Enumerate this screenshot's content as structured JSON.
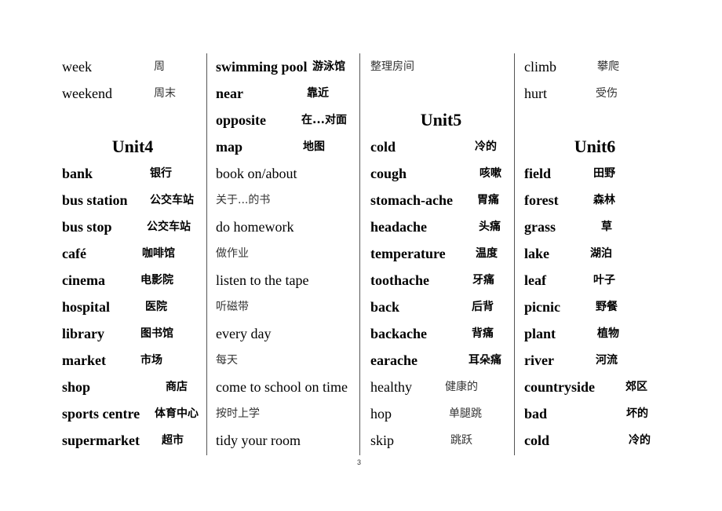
{
  "page_number": "3",
  "columns": [
    {
      "rows": [
        {
          "type": "pair",
          "en": "week",
          "zh": "周",
          "bold": false
        },
        {
          "type": "pair",
          "en": "weekend",
          "zh": "周末",
          "bold": false
        },
        {
          "type": "blank"
        },
        {
          "type": "heading",
          "text": "Unit4"
        },
        {
          "type": "pair",
          "en": "bank",
          "zh": "银行",
          "bold": true
        },
        {
          "type": "pair",
          "en": "bus station",
          "zh": "公交车站",
          "bold": true
        },
        {
          "type": "pair",
          "en": "bus stop",
          "zh": "公交车站",
          "bold": true
        },
        {
          "type": "pair",
          "en": "café",
          "zh": "咖啡馆",
          "bold": true
        },
        {
          "type": "pair",
          "en": "cinema",
          "zh": "电影院",
          "bold": true
        },
        {
          "type": "pair",
          "en": "hospital",
          "zh": "医院",
          "bold": true
        },
        {
          "type": "pair",
          "en": "library",
          "zh": "图书馆",
          "bold": true
        },
        {
          "type": "pair",
          "en": "market",
          "zh": "市场",
          "bold": true
        },
        {
          "type": "pair",
          "en": "shop",
          "zh": "商店",
          "bold": true
        },
        {
          "type": "pair",
          "en": "sports centre",
          "zh": "体育中心",
          "bold": true
        },
        {
          "type": "pair",
          "en": "supermarket",
          "zh": "超市",
          "bold": true
        }
      ]
    },
    {
      "rows": [
        {
          "type": "pair",
          "en": "swimming pool",
          "zh": "游泳馆",
          "bold": true
        },
        {
          "type": "pair",
          "en": "near",
          "zh": "靠近",
          "bold": true
        },
        {
          "type": "pair",
          "en": "opposite",
          "zh": "在...对面",
          "bold": true
        },
        {
          "type": "pair",
          "en": "map",
          "zh": "地图",
          "bold": true
        },
        {
          "type": "en",
          "text": "book on/about"
        },
        {
          "type": "zh",
          "text": "关于...的书"
        },
        {
          "type": "en",
          "text": "do homework"
        },
        {
          "type": "zh",
          "text": "做作业"
        },
        {
          "type": "en",
          "text": "listen to the tape"
        },
        {
          "type": "zh",
          "text": "听磁带"
        },
        {
          "type": "en",
          "text": "every day"
        },
        {
          "type": "zh",
          "text": "每天"
        },
        {
          "type": "en",
          "text": "come to school on time"
        },
        {
          "type": "zh",
          "text": "按时上学"
        },
        {
          "type": "en",
          "text": "tidy your room"
        }
      ]
    },
    {
      "rows": [
        {
          "type": "zh",
          "text": "整理房间"
        },
        {
          "type": "blank"
        },
        {
          "type": "heading",
          "text": "Unit5"
        },
        {
          "type": "pair",
          "en": "cold",
          "zh": "冷的",
          "bold": true
        },
        {
          "type": "pair",
          "en": "cough",
          "zh": "咳嗽",
          "bold": true
        },
        {
          "type": "pair",
          "en": "stomach-ache",
          "zh": "胃痛",
          "bold": true
        },
        {
          "type": "pair",
          "en": "headache",
          "zh": "头痛",
          "bold": true
        },
        {
          "type": "pair",
          "en": "temperature",
          "zh": "温度",
          "bold": true
        },
        {
          "type": "pair",
          "en": "toothache",
          "zh": "牙痛",
          "bold": true
        },
        {
          "type": "pair",
          "en": "back",
          "zh": "后背",
          "bold": true
        },
        {
          "type": "pair",
          "en": "backache",
          "zh": "背痛",
          "bold": true
        },
        {
          "type": "pair",
          "en": "earache",
          "zh": "耳朵痛",
          "bold": true
        },
        {
          "type": "pair",
          "en": "healthy",
          "zh": "健康的",
          "bold": false
        },
        {
          "type": "pair",
          "en": "hop",
          "zh": "单腿跳",
          "bold": false
        },
        {
          "type": "pair",
          "en": "skip",
          "zh": "跳跃",
          "bold": false
        }
      ]
    },
    {
      "rows": [
        {
          "type": "pair",
          "en": "climb",
          "zh": "攀爬",
          "bold": false
        },
        {
          "type": "pair",
          "en": "hurt",
          "zh": "受伤",
          "bold": false
        },
        {
          "type": "blank"
        },
        {
          "type": "heading",
          "text": "Unit6"
        },
        {
          "type": "pair",
          "en": "field",
          "zh": "田野",
          "bold": true
        },
        {
          "type": "pair",
          "en": "forest",
          "zh": "森林",
          "bold": true
        },
        {
          "type": "pair",
          "en": "grass",
          "zh": "草",
          "bold": true
        },
        {
          "type": "pair",
          "en": "lake",
          "zh": "湖泊",
          "bold": true
        },
        {
          "type": "pair",
          "en": "leaf",
          "zh": "叶子",
          "bold": true
        },
        {
          "type": "pair",
          "en": "picnic",
          "zh": "野餐",
          "bold": true
        },
        {
          "type": "pair",
          "en": "plant",
          "zh": "植物",
          "bold": true
        },
        {
          "type": "pair",
          "en": "river",
          "zh": "河流",
          "bold": true
        },
        {
          "type": "pair",
          "en": "countryside",
          "zh": "郊区",
          "bold": true
        },
        {
          "type": "pair",
          "en": "bad",
          "zh": "坏的",
          "bold": true
        },
        {
          "type": "pair",
          "en": "cold",
          "zh": "冷的",
          "bold": true
        }
      ]
    }
  ]
}
